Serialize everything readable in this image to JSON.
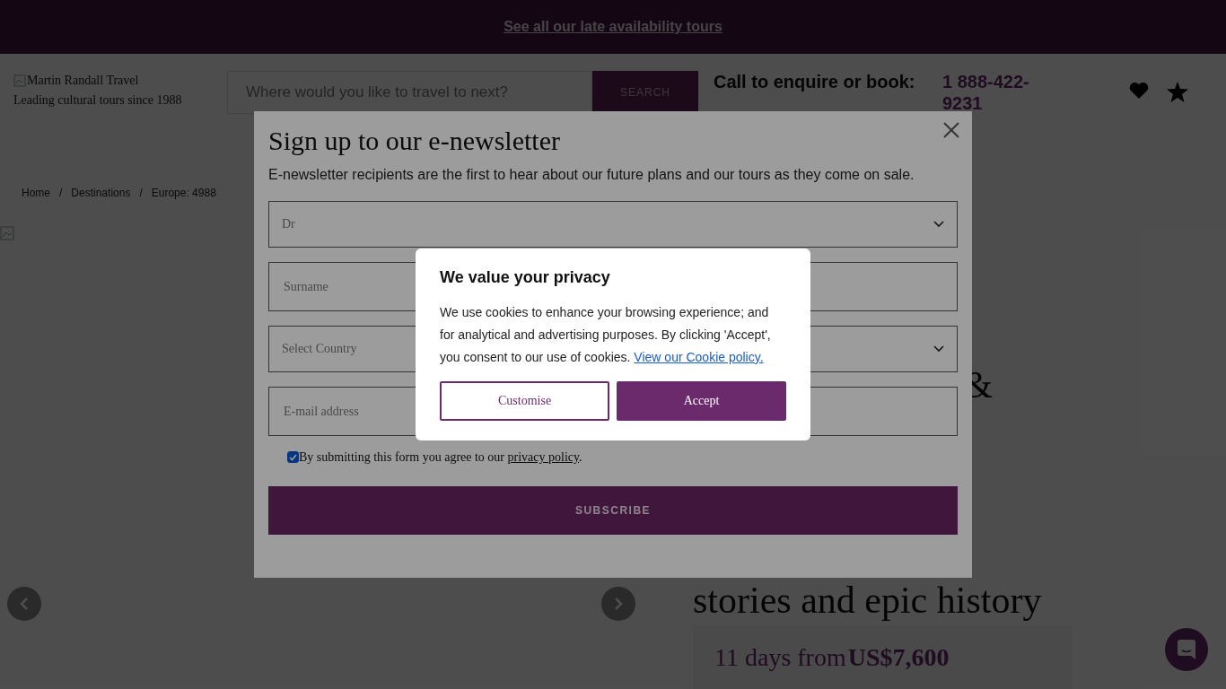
{
  "banner": {
    "link": "See all our late availability tours"
  },
  "header": {
    "logo_alt": "Martin Randall Travel",
    "tagline": "Leading cultural tours since 1988",
    "search": {
      "placeholder": "Where would you like to travel to next?",
      "button": "SEARCH"
    },
    "call_label": "Call to enquire or book:",
    "phone": "1 888-422-9231"
  },
  "breadcrumbs": [
    "Home",
    "Destinations",
    "Europe: 4988"
  ],
  "breadcrumb_separator": "/",
  "tour": {
    "title_fragments": [
      "&",
      "stories and epic history"
    ],
    "duration": "11 days from",
    "price": "US$7,600"
  },
  "newsletter": {
    "title": "Sign up to our e-newsletter",
    "intro": "E-newsletter recipients are the first to hear about our future plans and our tours as they come on sale.",
    "fields": [
      {
        "kind": "select",
        "value": "Dr"
      },
      {
        "kind": "text",
        "placeholder": "Surname"
      },
      {
        "kind": "select",
        "placeholder": "Select Country"
      },
      {
        "kind": "text",
        "placeholder": "E-mail address"
      }
    ],
    "consent": {
      "checked": true,
      "text": "By submitting this form you agree to our ",
      "link": "privacy policy",
      "end": "."
    },
    "button": "SUBSCRIBE"
  },
  "cookie": {
    "title": "We value your privacy",
    "text": "We use cookies to enhance your browsing experience; and for analytical and advertising purposes. By clicking 'Accept', you consent to our use of cookies.",
    "link": "View our Cookie policy.",
    "buttons": [
      {
        "label": "Customise",
        "kind": "secondary"
      },
      {
        "label": "Accept",
        "kind": "primary"
      }
    ]
  }
}
